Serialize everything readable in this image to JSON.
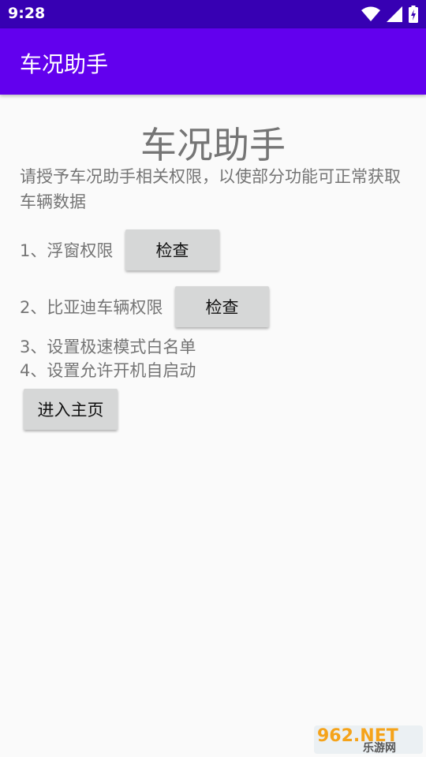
{
  "status_bar": {
    "time": "9:28",
    "icons": [
      "wifi-icon",
      "signal-icon",
      "battery-icon"
    ]
  },
  "app_bar": {
    "title": "车况助手"
  },
  "main": {
    "title": "车况助手",
    "intro_line1": "请授予车况助手相关权限，以使部分功能可正常获取",
    "intro_line2": "车辆数据",
    "items": [
      {
        "label": "1、浮窗权限",
        "button": "检查"
      },
      {
        "label": "2、比亚迪车辆权限",
        "button": "检查"
      },
      {
        "label": "3、设置极速模式白名单"
      },
      {
        "label": "4、设置允许开机自启动"
      }
    ],
    "enter_button": "进入主页"
  },
  "watermark": {
    "brand": "962.NET",
    "site": "乐游网"
  },
  "colors": {
    "status_bar": "#3700b3",
    "app_bar": "#6200ee",
    "background": "#fafafa",
    "text_gray": "#757575",
    "button_bg": "#d6d7d7"
  }
}
